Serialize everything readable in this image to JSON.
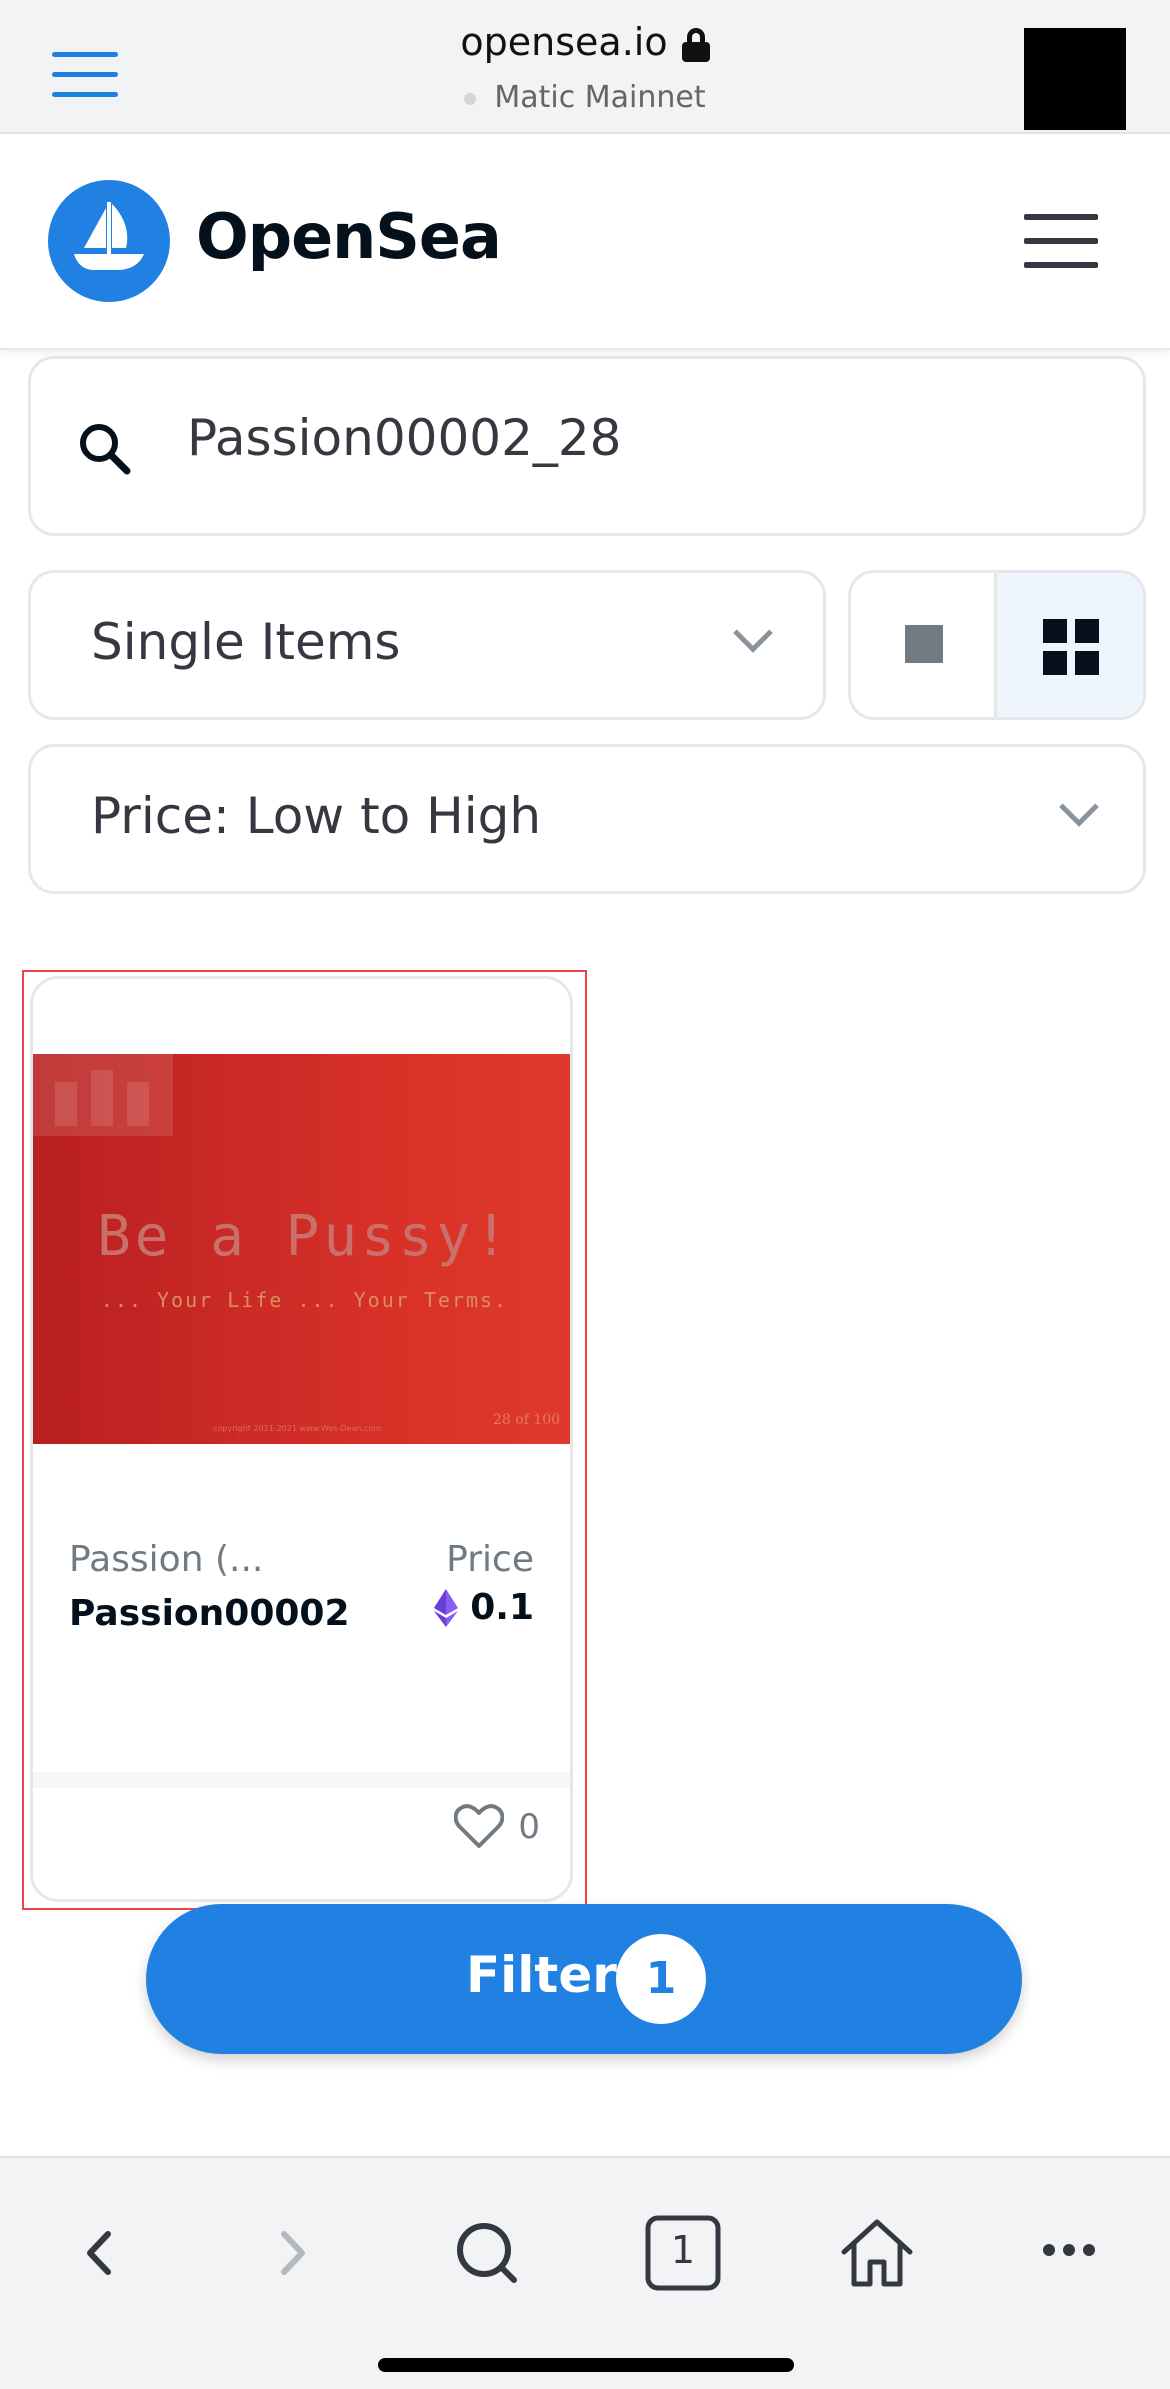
{
  "browser": {
    "url": "opensea.io",
    "network": "Matic Mainnet"
  },
  "header": {
    "brand": "OpenSea"
  },
  "search": {
    "value": "Passion00002_28"
  },
  "filters": {
    "item_type": "Single Items",
    "sort": "Price: Low to High"
  },
  "card": {
    "image_title": "Be a Pussy!",
    "image_subtitle": "... Your Life ... Your Terms.",
    "image_copyright": "copyright 2011-2021 www.Wes-Dean.com",
    "image_edition": "28 of 100",
    "collection": "Passion (...",
    "name": "Passion00002",
    "price_label": "Price",
    "price": "0.1",
    "favorites": "0"
  },
  "filter_button": {
    "label": "Filter",
    "count": "1"
  },
  "toolbar": {
    "tabs_count": "1"
  },
  "colors": {
    "brand_blue": "#2081e2",
    "text_dark": "#04111d",
    "text_muted": "#707a83",
    "eth_purple": "#8a5cf5"
  }
}
